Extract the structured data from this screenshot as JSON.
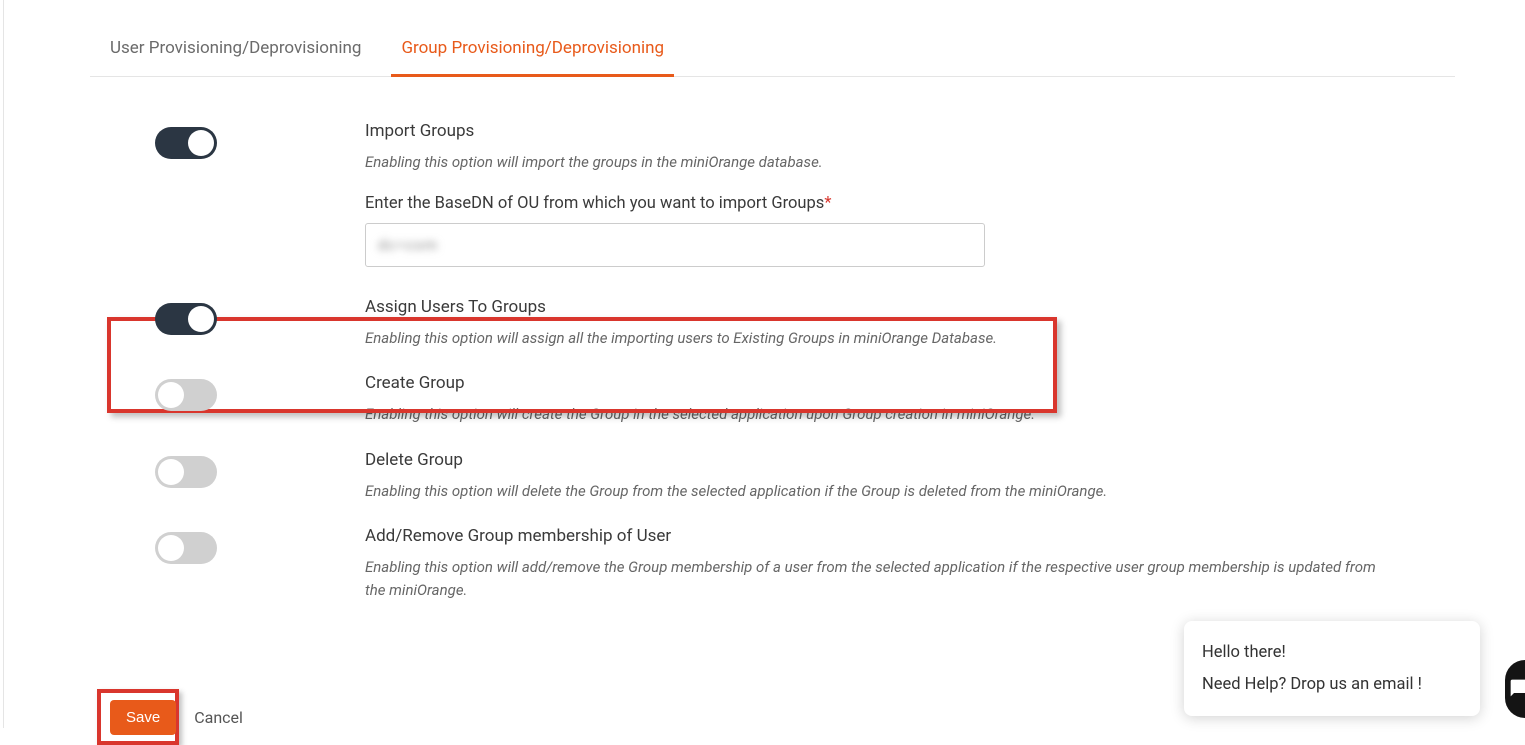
{
  "tabs": {
    "user": "User Provisioning/Deprovisioning",
    "group": "Group Provisioning/Deprovisioning"
  },
  "import_groups": {
    "title": "Import Groups",
    "desc": "Enabling this option will import the groups in the miniOrange database."
  },
  "basedn": {
    "label": "Enter the BaseDN of OU from which you want to import Groups",
    "required_marker": "*",
    "value": "dc=com"
  },
  "assign_users": {
    "title": "Assign Users To Groups",
    "desc": "Enabling this option will assign all the importing users to Existing Groups in miniOrange Database."
  },
  "create_group": {
    "title": "Create Group",
    "desc": "Enabling this option will create the Group in the selected application upon Group creation in miniOrange."
  },
  "delete_group": {
    "title": "Delete Group",
    "desc": "Enabling this option will delete the Group from the selected application if the Group is deleted from the miniOrange."
  },
  "add_remove": {
    "title": "Add/Remove Group membership of User",
    "desc": "Enabling this option will add/remove the Group membership of a user from the selected application if the respective user group membership is updated from the miniOrange."
  },
  "buttons": {
    "save": "Save",
    "cancel": "Cancel"
  },
  "help": {
    "line1": "Hello there!",
    "line2": "Need Help? Drop us an email !"
  }
}
